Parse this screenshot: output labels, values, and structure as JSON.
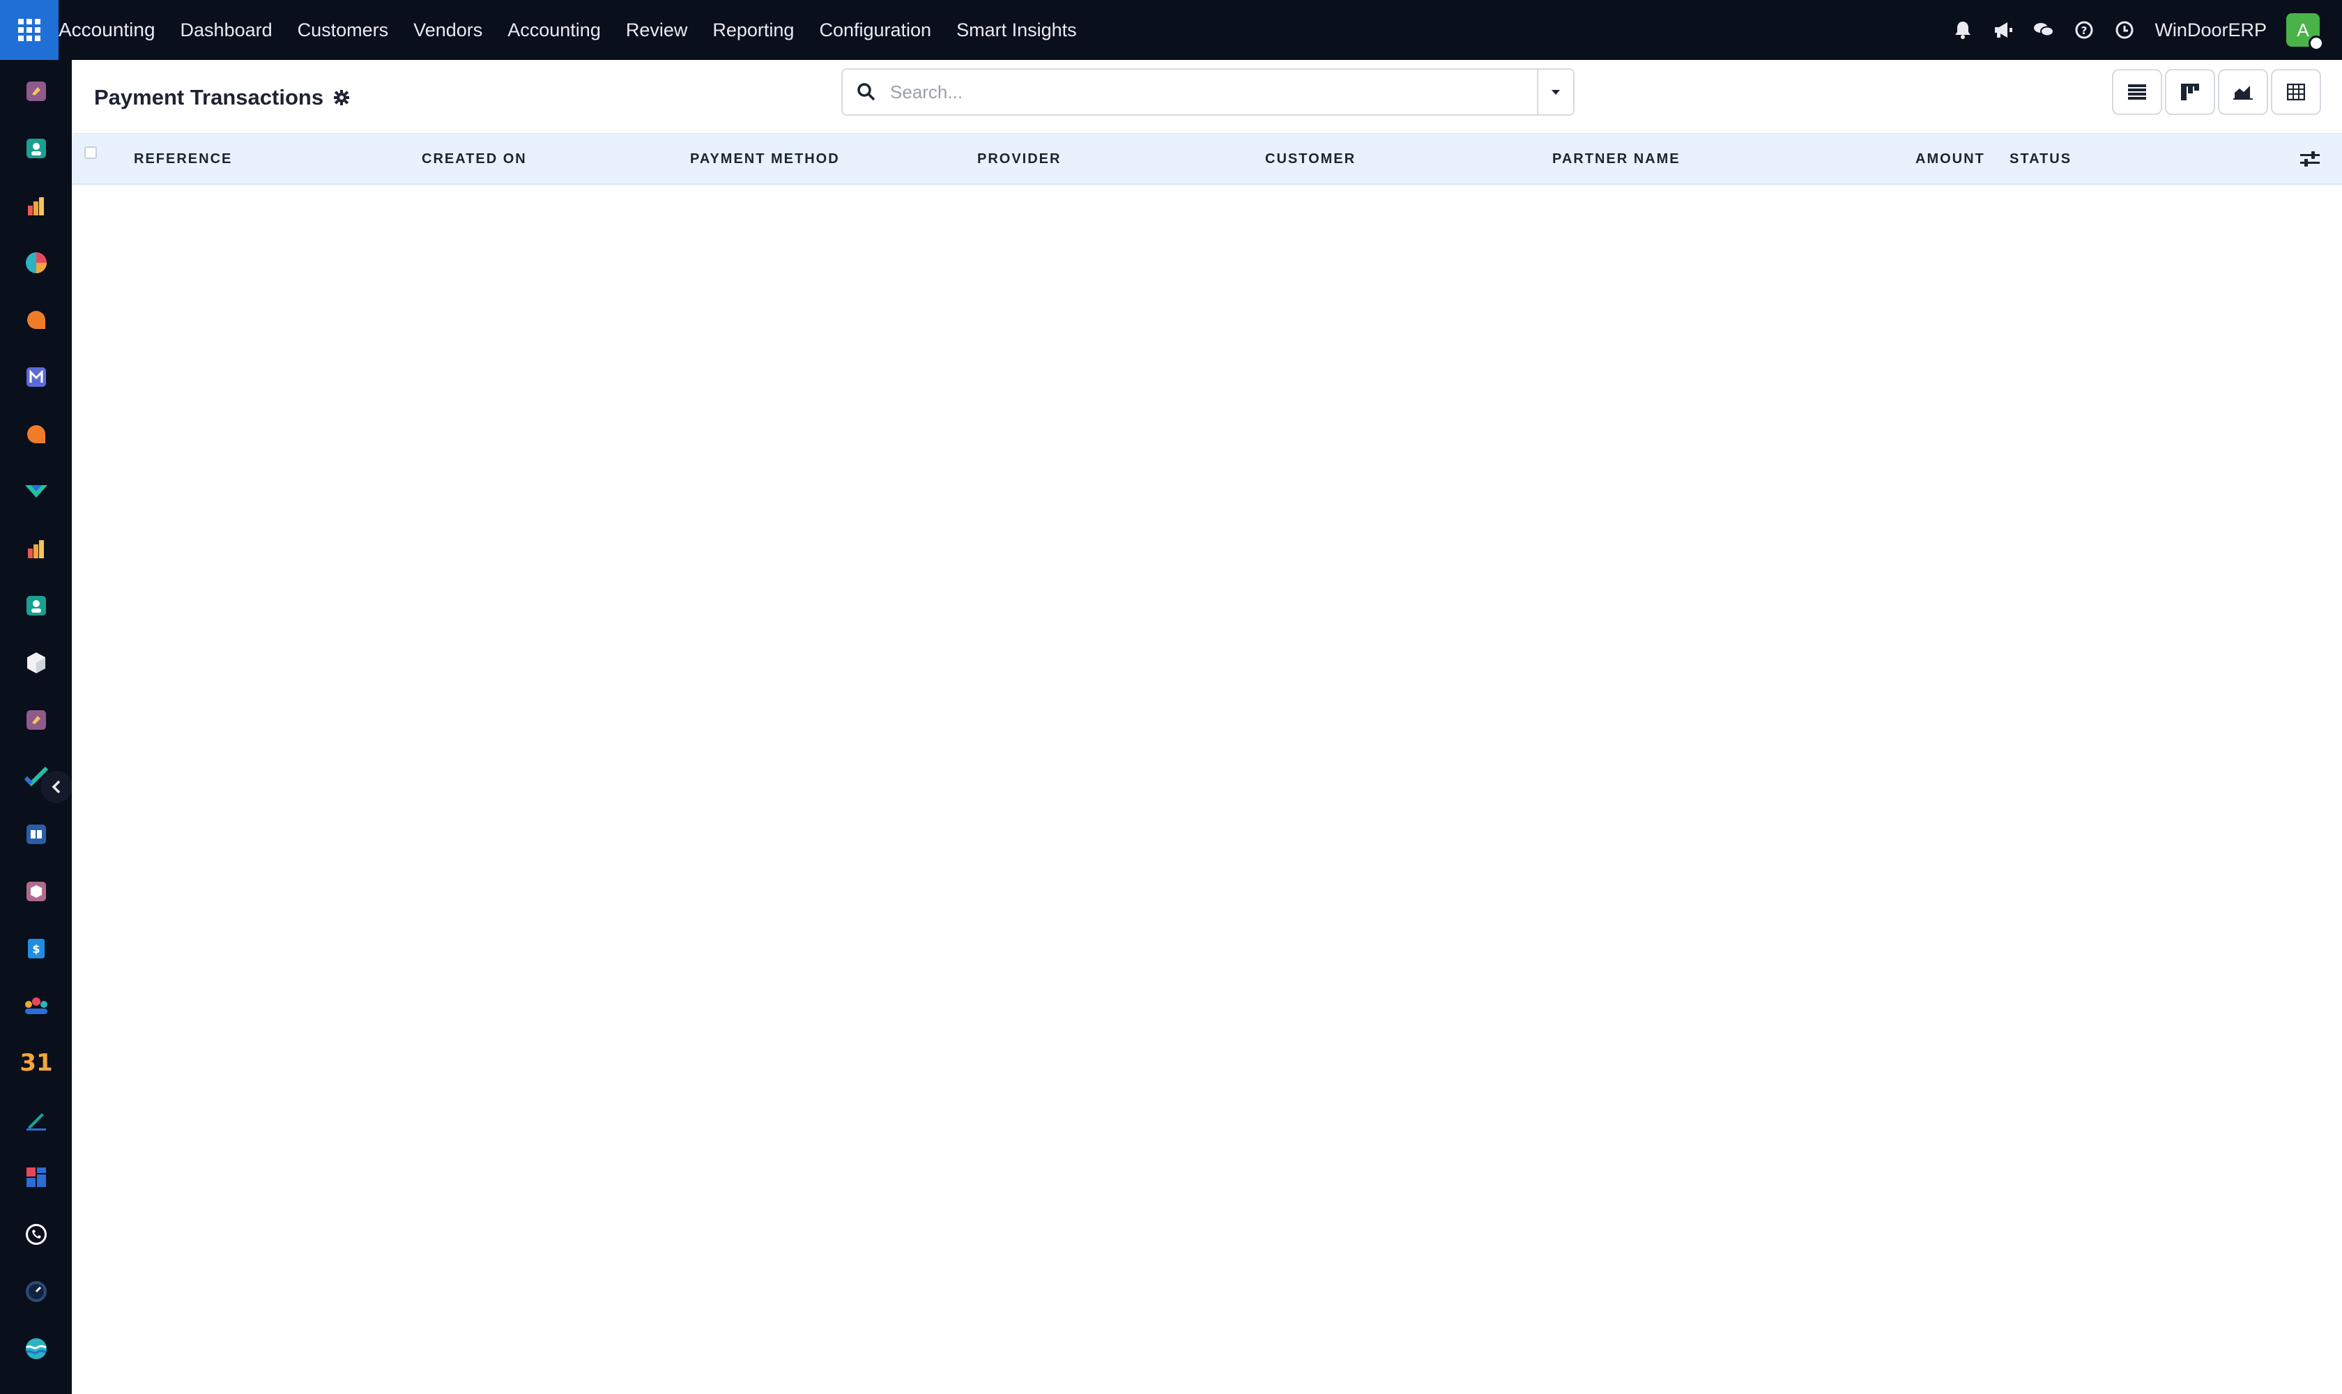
{
  "topbar": {
    "brand": "Accounting",
    "menu": [
      "Dashboard",
      "Customers",
      "Vendors",
      "Accounting",
      "Review",
      "Reporting",
      "Configuration",
      "Smart Insights"
    ],
    "company": "WinDoorERP",
    "avatar_initial": "A"
  },
  "rail": {
    "apps": [
      "app-icon-1",
      "contacts-icon",
      "reporting-icon",
      "pie-icon",
      "chat-icon",
      "mail-icon",
      "discuss-icon",
      "mark-icon",
      "reporting-icon-2",
      "contacts-icon-2",
      "cube-icon",
      "app-icon-2",
      "check-icon",
      "knowledge-icon",
      "box-icon",
      "invoice-icon",
      "team-icon",
      "calendar-icon",
      "sign-icon",
      "dashboard-icon",
      "whatsapp-icon",
      "clock-icon",
      "wave-icon"
    ],
    "calendar_label": "31"
  },
  "control": {
    "title": "Payment Transactions",
    "search_placeholder": "Search..."
  },
  "table": {
    "columns": [
      "Reference",
      "Created On",
      "Payment Method",
      "Provider",
      "Customer",
      "Partner Name",
      "Amount",
      "Status"
    ]
  },
  "colors": {
    "topbar_bg": "#0a0f1c",
    "apps_btn_bg": "#1f6fd6",
    "header_bg": "#e9f2fc",
    "avatar_bg": "#49b34a"
  }
}
